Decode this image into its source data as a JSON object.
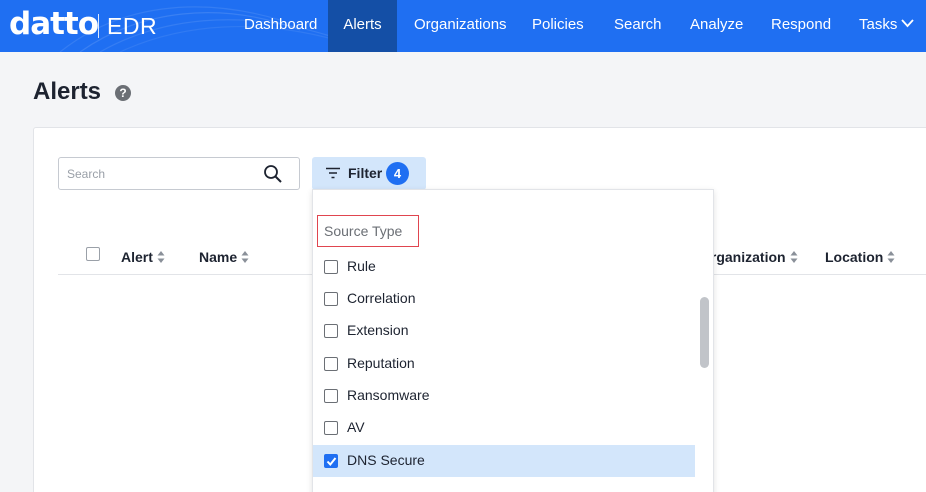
{
  "brand": {
    "logo_text": "datto",
    "product": "EDR"
  },
  "nav": {
    "items": [
      {
        "label": "Dashboard"
      },
      {
        "label": "Alerts"
      },
      {
        "label": "Organizations"
      },
      {
        "label": "Policies"
      },
      {
        "label": "Search"
      },
      {
        "label": "Analyze"
      },
      {
        "label": "Respond"
      },
      {
        "label": "Tasks"
      }
    ],
    "active": "Alerts"
  },
  "page": {
    "title": "Alerts",
    "help_icon": "?"
  },
  "toolbar": {
    "search_placeholder": "Search",
    "search_value": "",
    "filter_label": "Filter",
    "filter_count": "4"
  },
  "table": {
    "columns": [
      {
        "label": "Alert"
      },
      {
        "label": "Name"
      },
      {
        "label": "Organization"
      },
      {
        "label": "Location"
      }
    ]
  },
  "filter_panel": {
    "section_title": "Source Type",
    "options": [
      {
        "label": "Rule",
        "checked": false
      },
      {
        "label": "Correlation",
        "checked": false
      },
      {
        "label": "Extension",
        "checked": false
      },
      {
        "label": "Reputation",
        "checked": false
      },
      {
        "label": "Ransomware",
        "checked": false
      },
      {
        "label": "AV",
        "checked": false
      },
      {
        "label": "DNS Secure",
        "checked": true
      }
    ]
  },
  "colors": {
    "nav_bg": "#1f6ff2",
    "nav_active_bg": "#144fa6",
    "filter_bg": "#d3e6fb",
    "badge_bg": "#1f6ff2",
    "highlight_border": "#e0454f"
  }
}
